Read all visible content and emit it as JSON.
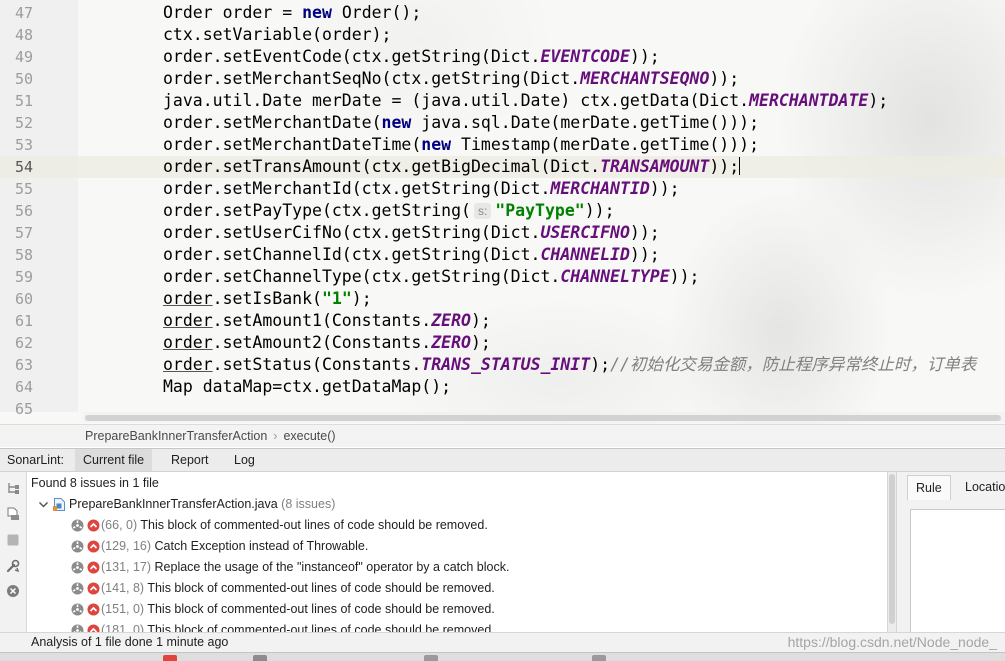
{
  "editor": {
    "lines": [
      {
        "num": "47",
        "segments": [
          {
            "t": "plain",
            "v": "Order order = "
          },
          {
            "t": "kw",
            "v": "new"
          },
          {
            "t": "plain",
            "v": " Order();"
          }
        ]
      },
      {
        "num": "48",
        "segments": [
          {
            "t": "plain",
            "v": "ctx.setVariable(order);"
          }
        ]
      },
      {
        "num": "49",
        "segments": [
          {
            "t": "plain",
            "v": "order.setEventCode(ctx.getString(Dict."
          },
          {
            "t": "const",
            "v": "EVENTCODE"
          },
          {
            "t": "plain",
            "v": "));"
          }
        ]
      },
      {
        "num": "50",
        "segments": [
          {
            "t": "plain",
            "v": "order.setMerchantSeqNo(ctx.getString(Dict."
          },
          {
            "t": "const",
            "v": "MERCHANTSEQNO"
          },
          {
            "t": "plain",
            "v": "));"
          }
        ]
      },
      {
        "num": "51",
        "segments": [
          {
            "t": "plain",
            "v": "java.util.Date merDate = (java.util.Date) ctx.getData(Dict."
          },
          {
            "t": "const",
            "v": "MERCHANTDATE"
          },
          {
            "t": "plain",
            "v": ");"
          }
        ]
      },
      {
        "num": "52",
        "segments": [
          {
            "t": "plain",
            "v": "order.setMerchantDate("
          },
          {
            "t": "kw",
            "v": "new"
          },
          {
            "t": "plain",
            "v": " java.sql.Date(merDate.getTime()));"
          }
        ]
      },
      {
        "num": "53",
        "segments": [
          {
            "t": "plain",
            "v": "order.setMerchantDateTime("
          },
          {
            "t": "kw",
            "v": "new"
          },
          {
            "t": "plain",
            "v": " Timestamp(merDate.getTime()));"
          }
        ]
      },
      {
        "num": "54",
        "current": true,
        "caret": true,
        "segments": [
          {
            "t": "plain",
            "v": "order.setTransAmount(ctx.getBigDecimal(Dict."
          },
          {
            "t": "const",
            "v": "TRANSAMOUNT"
          },
          {
            "t": "plain",
            "v": "));"
          }
        ]
      },
      {
        "num": "55",
        "segments": [
          {
            "t": "plain",
            "v": "order.setMerchantId(ctx.getString(Dict."
          },
          {
            "t": "const",
            "v": "MERCHANTID"
          },
          {
            "t": "plain",
            "v": "));"
          }
        ]
      },
      {
        "num": "56",
        "segments": [
          {
            "t": "plain",
            "v": "order.setPayType(ctx.getString("
          },
          {
            "t": "hint",
            "v": "s:"
          },
          {
            "t": "str",
            "v": "\"PayType\""
          },
          {
            "t": "plain",
            "v": "));"
          }
        ]
      },
      {
        "num": "57",
        "segments": [
          {
            "t": "plain",
            "v": "order.setUserCifNo(ctx.getString(Dict."
          },
          {
            "t": "const",
            "v": "USERCIFNO"
          },
          {
            "t": "plain",
            "v": "));"
          }
        ]
      },
      {
        "num": "58",
        "segments": [
          {
            "t": "plain",
            "v": "order.setChannelId(ctx.getString(Dict."
          },
          {
            "t": "const",
            "v": "CHANNELID"
          },
          {
            "t": "plain",
            "v": "));"
          }
        ]
      },
      {
        "num": "59",
        "segments": [
          {
            "t": "plain",
            "v": "order.setChannelType(ctx.getString(Dict."
          },
          {
            "t": "const",
            "v": "CHANNELTYPE"
          },
          {
            "t": "plain",
            "v": "));"
          }
        ]
      },
      {
        "num": "60",
        "segments": [
          {
            "t": "warn",
            "v": "order"
          },
          {
            "t": "plain",
            "v": ".setIsBank("
          },
          {
            "t": "str",
            "v": "\"1\""
          },
          {
            "t": "plain",
            "v": ");"
          }
        ]
      },
      {
        "num": "61",
        "segments": [
          {
            "t": "warn",
            "v": "order"
          },
          {
            "t": "plain",
            "v": ".setAmount1(Constants."
          },
          {
            "t": "const",
            "v": "ZERO"
          },
          {
            "t": "plain",
            "v": ");"
          }
        ]
      },
      {
        "num": "62",
        "segments": [
          {
            "t": "warn",
            "v": "order"
          },
          {
            "t": "plain",
            "v": ".setAmount2(Constants."
          },
          {
            "t": "const",
            "v": "ZERO"
          },
          {
            "t": "plain",
            "v": ");"
          }
        ]
      },
      {
        "num": "63",
        "segments": [
          {
            "t": "warn",
            "v": "order"
          },
          {
            "t": "plain",
            "v": ".setStatus(Constants."
          },
          {
            "t": "const",
            "v": "TRANS_STATUS_INIT"
          },
          {
            "t": "plain",
            "v": ");"
          },
          {
            "t": "comment",
            "v": "//初始化交易金额，防止程序异常终止时，订单表"
          }
        ]
      },
      {
        "num": "64",
        "segments": [
          {
            "t": "plain",
            "v": "Map dataMap=ctx.getDataMap();"
          }
        ]
      },
      {
        "num": "65",
        "segments": []
      }
    ]
  },
  "breadcrumb": {
    "class_name": "PrepareBankInnerTransferAction",
    "separator": "›",
    "method": "execute()"
  },
  "sonarlint": {
    "title": "SonarLint:",
    "tabs": [
      {
        "label": "Current file",
        "selected": true
      },
      {
        "label": "Report",
        "selected": false
      },
      {
        "label": "Log",
        "selected": false
      }
    ]
  },
  "issues": {
    "summary": "Found 8 issues in 1 file",
    "file": {
      "name": "PrepareBankInnerTransferAction.java",
      "count": "(8 issues)"
    },
    "items": [
      {
        "location": "(66, 0)",
        "message": "This block of commented-out lines of code should be removed."
      },
      {
        "location": "(129, 16)",
        "message": "Catch Exception instead of Throwable."
      },
      {
        "location": "(131, 17)",
        "message": "Replace the usage of the \"instanceof\" operator by a catch block."
      },
      {
        "location": "(141, 8)",
        "message": "This block of commented-out lines of code should be removed."
      },
      {
        "location": "(151, 0)",
        "message": "This block of commented-out lines of code should be removed."
      },
      {
        "location": "(181, 0)",
        "message": "This block of commented-out lines of code should be removed."
      }
    ]
  },
  "details": {
    "tabs": [
      {
        "label": "Rule",
        "selected": true
      },
      {
        "label": "Location",
        "selected": false
      }
    ]
  },
  "status": {
    "text": "Analysis of 1 file done 1 minute ago"
  },
  "watermark": {
    "text": "https://blog.csdn.net/Node_node_"
  },
  "colors": {
    "plain": "#000000",
    "kw": "#000080",
    "const": "#660e7a",
    "str": "#008000",
    "comment": "#808080",
    "warn": "#000000",
    "hint": "#8c8c8c",
    "severity_major": "#e0443e",
    "code_smell": "#8c8c8c"
  },
  "icons": {
    "side_toolbar": [
      "hierarchy-icon",
      "files-icon",
      "stop-icon",
      "tools-icon",
      "clear-icon"
    ],
    "file_row": [
      "chevron-down-icon",
      "java-file-icon"
    ],
    "issue_row": [
      "code-smell-icon",
      "major-severity-icon"
    ],
    "bottom_strip": [
      "problems-icon",
      "terminal-icon",
      "todo-icon",
      "build-icon"
    ]
  }
}
